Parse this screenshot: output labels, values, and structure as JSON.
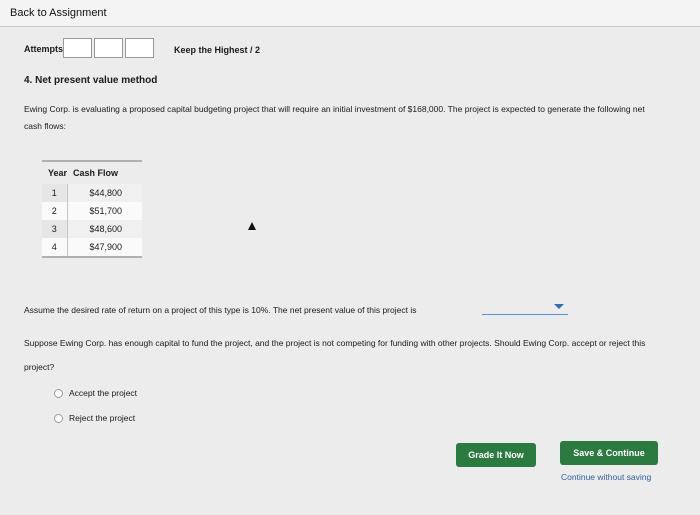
{
  "nav": {
    "back_label": "Back to Assignment"
  },
  "attempts": {
    "label": "Attempts",
    "boxes": [
      "",
      "",
      ""
    ],
    "keep_label": "Keep the Highest / 2"
  },
  "question": {
    "title": "4. Net present value method",
    "intro": "Ewing Corp. is evaluating a proposed capital budgeting project that will require an initial investment of $168,000. The project is expected to generate the following net cash flows:",
    "table": {
      "headers": [
        "Year",
        "Cash Flow"
      ],
      "rows": [
        {
          "year": "1",
          "cash": "$44,800"
        },
        {
          "year": "2",
          "cash": "$51,700"
        },
        {
          "year": "3",
          "cash": "$48,600"
        },
        {
          "year": "4",
          "cash": "$47,900"
        }
      ]
    },
    "npv_text": "Assume the desired rate of return on a project of this type is 10%. The net present value of this project is",
    "npv_selected": "",
    "suppose_text": "Suppose Ewing Corp. has enough capital to fund the project, and the project is not competing for funding with other projects. Should Ewing Corp. accept or reject this project?",
    "options": [
      "Accept the project",
      "Reject the project"
    ]
  },
  "actions": {
    "grade_label": "Grade It Now",
    "save_label": "Save & Continue",
    "continue_label": "Continue without saving"
  },
  "colors": {
    "button_green": "#2b7a3f",
    "link_blue": "#2f5f9e",
    "dropdown_blue": "#2f6db5"
  }
}
